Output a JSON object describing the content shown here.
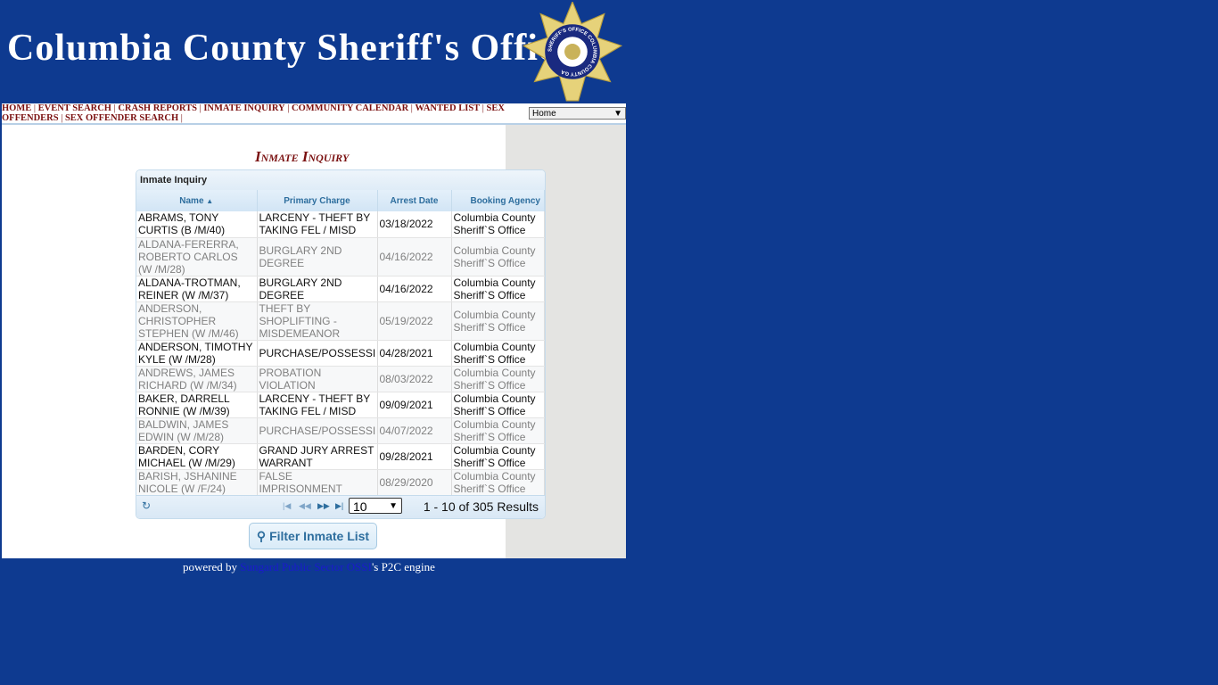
{
  "header": {
    "title": "Columbia County Sheriff's Office",
    "badge_text": "SHERIFF'S OFFICE COLUMBIA COUNTY GA"
  },
  "nav": {
    "items": [
      "HOME",
      "EVENT SEARCH",
      "CRASH REPORTS",
      "INMATE INQUIRY",
      "COMMUNITY CALENDAR",
      "WANTED LIST",
      "SEX OFFENDERS",
      "SEX OFFENDER SEARCH"
    ],
    "select_value": "Home"
  },
  "page_title": "Inmate Inquiry",
  "grid": {
    "caption": "Inmate Inquiry",
    "columns": [
      "Name",
      "Primary Charge",
      "Arrest Date",
      "Booking Agency"
    ],
    "sort": "Name ascending",
    "rows": [
      [
        "ABRAMS, TONY\nCURTIS (B /M/40)",
        "LARCENY - THEFT BY\nTAKING FEL / MISD",
        "03/18/2022",
        "Columbia County\nSheriff`S Office"
      ],
      [
        "ALDANA-FERERRA,\nROBERTO CARLOS\n(W /M/28)",
        "BURGLARY 2ND\nDEGREE",
        "04/16/2022",
        "Columbia County\nSheriff`S Office"
      ],
      [
        "ALDANA-TROTMAN,\nREINER (W /M/37)",
        "BURGLARY 2ND\nDEGREE",
        "04/16/2022",
        "Columbia County\nSheriff`S Office"
      ],
      [
        "ANDERSON,\nCHRISTOPHER\nSTEPHEN (W /M/46)",
        "THEFT BY\nSHOPLIFTING -\nMISDEMEANOR",
        "05/19/2022",
        "Columbia County\nSheriff`S Office"
      ],
      [
        "ANDERSON, TIMOTHY\nKYLE (W /M/28)",
        "PURCHASE/POSSESSI",
        "04/28/2021",
        "Columbia County\nSheriff`S Office"
      ],
      [
        "ANDREWS, JAMES\nRICHARD (W /M/34)",
        "PROBATION\nVIOLATION",
        "08/03/2022",
        "Columbia County\nSheriff`S Office"
      ],
      [
        "BAKER, DARRELL\nRONNIE (W /M/39)",
        "LARCENY - THEFT BY\nTAKING FEL / MISD",
        "09/09/2021",
        "Columbia County\nSheriff`S Office"
      ],
      [
        "BALDWIN, JAMES\nEDWIN (W /M/28)",
        "PURCHASE/POSSESSI",
        "04/07/2022",
        "Columbia County\nSheriff`S Office"
      ],
      [
        "BARDEN, CORY\nMICHAEL (W /M/29)",
        "GRAND JURY ARREST\nWARRANT",
        "09/28/2021",
        "Columbia County\nSheriff`S Office"
      ],
      [
        "BARISH, JSHANINE\nNICOLE (W /F/24)",
        "FALSE\nIMPRISONMENT",
        "08/29/2020",
        "Columbia County\nSheriff`S Office"
      ]
    ],
    "page_size": "10",
    "results": "1 - 10 of 305 Results"
  },
  "filter_button": "Filter Inmate List",
  "footer": {
    "prefix": "powered by ",
    "link": "Sungard Public Sector OSSI",
    "suffix": "'s P2C engine"
  },
  "colors": {
    "background": "#0e3a90",
    "title": "#7a1010",
    "grid_header": "#2e6e9e"
  }
}
